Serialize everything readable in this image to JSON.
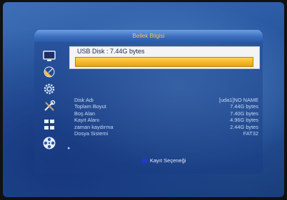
{
  "menu": {
    "title": "Bellek Bilgisi"
  },
  "usb": {
    "label": "USB Disk : 7.44G bytes",
    "used_fraction": 1.0
  },
  "details": [
    {
      "key": "Disk Adı",
      "value": "[uda1]NO NAME"
    },
    {
      "key": "Toplam Boyut",
      "value": "7.44G bytes"
    },
    {
      "key": "Boş Alan",
      "value": "7.40G bytes"
    },
    {
      "key": "Kayıt Alanı",
      "value": "4.96G bytes"
    },
    {
      "key": "zaman kaydırma",
      "value": "2.44G bytes"
    },
    {
      "key": "Dosya Sistemi",
      "value": "FAT32"
    }
  ],
  "footer": {
    "hint": "Kayıt Seçeneği",
    "key_color": "#2436d8"
  },
  "sidebar": {
    "icons": [
      "tv-icon",
      "satellite-dish-icon",
      "settings-gear-icon",
      "tools-icon",
      "network-icon",
      "media-reel-icon"
    ]
  },
  "colors": {
    "title_text": "#f3c45a",
    "bar_fill": "#f0b020"
  }
}
